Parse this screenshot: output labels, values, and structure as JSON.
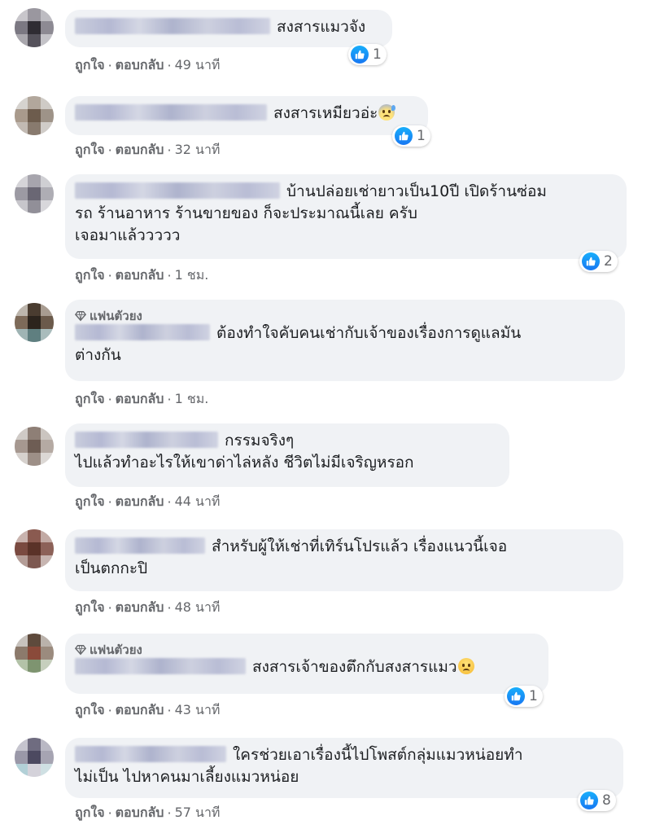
{
  "ui": {
    "like_label": "ถูกใจ",
    "reply_label": "ตอบกลับ",
    "separator": "·",
    "badge_label": "แฟนตัวยง"
  },
  "colors": {
    "bubble": "#f0f2f5",
    "meta_text": "#65676b",
    "like_blue": "#1877f2"
  },
  "comments": [
    {
      "text": "สงสารแมวจัง",
      "time": "49 นาที",
      "reactions": "1",
      "emoji": ""
    },
    {
      "text": "สงสารเหมียวอ่ะ",
      "time": "32 นาที",
      "reactions": "1",
      "emoji": "anxious-face"
    },
    {
      "text_line1": "บ้านปล่อยเช่ายาวเป็น10ปี เปิดร้านซ่อม",
      "text_line2": "รถ ร้านอาหาร ร้านขายของ ก็จะประมาณนี้เลย ครับ",
      "text_line3": "เจอมาแล้ววววว",
      "time": "1 ชม.",
      "reactions": "2"
    },
    {
      "badge": true,
      "text_line1": "ต้องทำใจคับคนเช่ากับเจ้าของเรื่องการดูแลมัน",
      "text_line2": "ต่างกัน",
      "time": "1 ชม."
    },
    {
      "text_line1": "กรรมจริงๆ",
      "text_line2": "ไปแล้วทำอะไรให้เขาด่าไล่หลัง ชีวิตไม่มีเจริญหรอก",
      "time": "44 นาที"
    },
    {
      "text_line1": "สำหรับผู้ให้เช่าที่เทิร์นโปรแล้ว เรื่องแนวนี้เจอ",
      "text_line2": "เป็นตกกะปิ",
      "time": "48 นาที"
    },
    {
      "badge": true,
      "text": "สงสารเจ้าของตึกกับสงสารแมว",
      "time": "43 นาที",
      "reactions": "1",
      "emoji": "sad-face"
    },
    {
      "text_line1": "ใครช่วยเอาเรื่องนี้ไปโพสต์กลุ่มแมวหน่อยทำ",
      "text_line2": "ไม่เป็น ไปหาคนมาเลี้ยงแมวหน่อย",
      "time": "57 นาที",
      "reactions": "8"
    }
  ]
}
